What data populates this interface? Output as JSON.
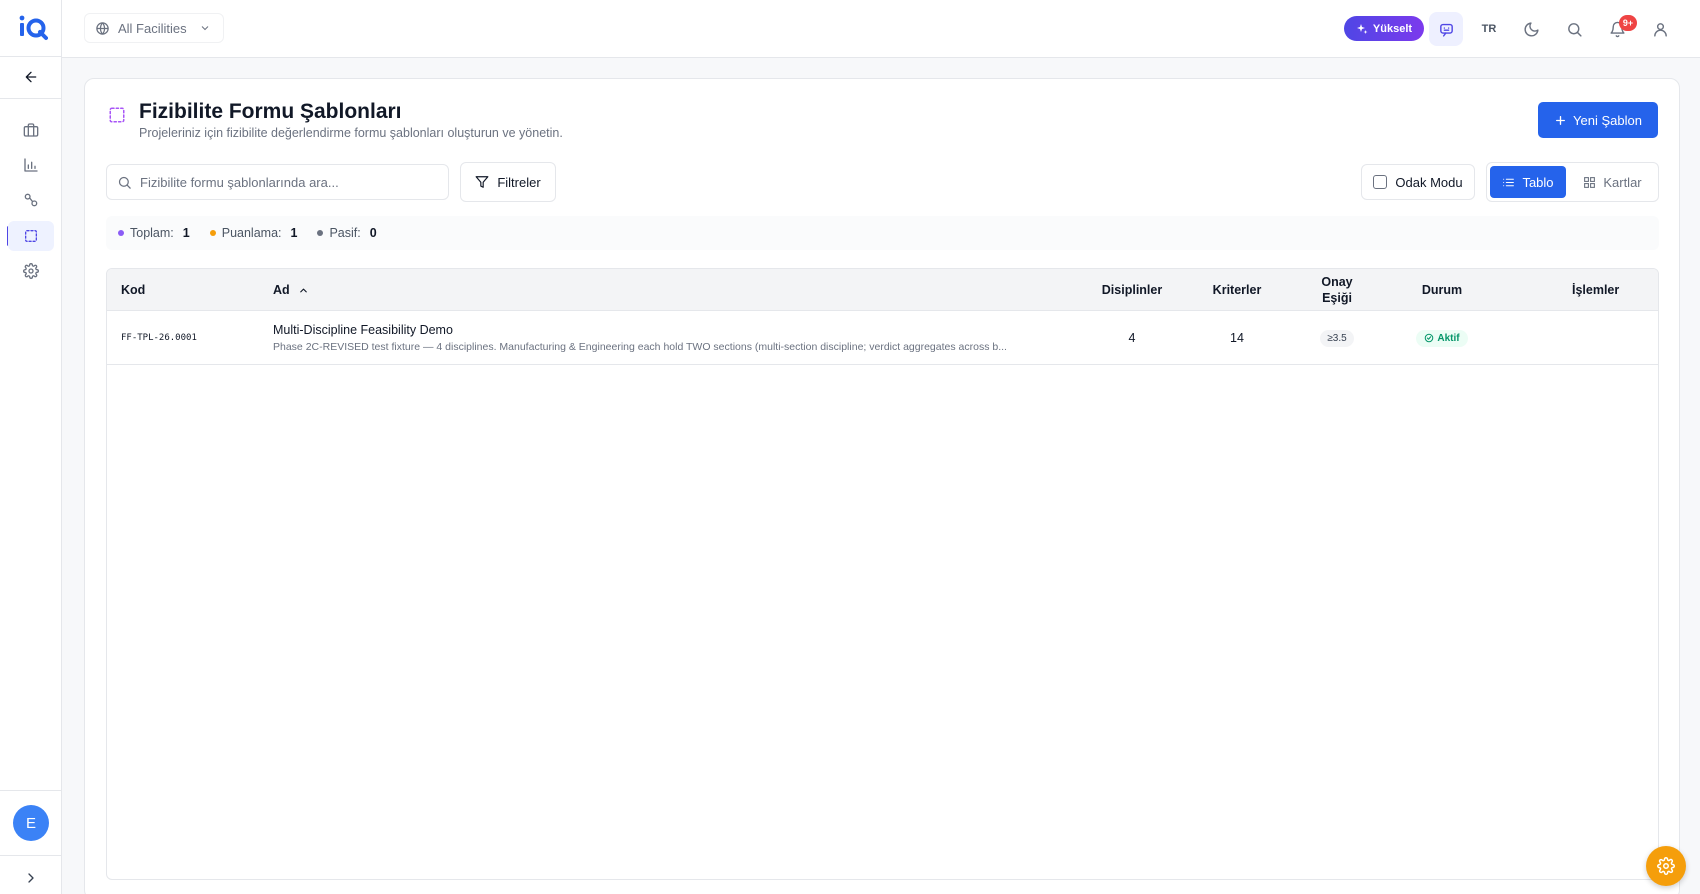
{
  "app": {
    "logo_text": "iQ",
    "brand_color": "#2563eb",
    "accent_color": "#4f46e5"
  },
  "topbar": {
    "facility_selector": "All Facilities",
    "upgrade_label": "Yükselt",
    "language": "TR",
    "notification_count": "9+"
  },
  "sidebar": {
    "items": [
      {
        "icon": "arrow-left-icon"
      },
      {
        "icon": "briefcase-icon"
      },
      {
        "icon": "bar-chart-icon"
      },
      {
        "icon": "workflow-icon"
      },
      {
        "icon": "dashed-square-icon",
        "active": true
      },
      {
        "icon": "gear-icon"
      }
    ],
    "user_initial": "E"
  },
  "page": {
    "title": "Fizibilite Formu Şablonları",
    "subtitle": "Projeleriniz için fizibilite değerlendirme formu şablonları oluşturun ve yönetin.",
    "new_button": "Yeni Şablon"
  },
  "toolbar": {
    "search_placeholder": "Fizibilite formu şablonlarında ara...",
    "filter_label": "Filtreler",
    "focus_mode_label": "Odak Modu",
    "view_table_label": "Tablo",
    "view_cards_label": "Kartlar"
  },
  "stats": [
    {
      "label": "Toplam:",
      "value": "1",
      "color": "#8b5cf6"
    },
    {
      "label": "Puanlama:",
      "value": "1",
      "color": "#f59e0b"
    },
    {
      "label": "Pasif:",
      "value": "0",
      "color": "#6b7280"
    }
  ],
  "table": {
    "columns": {
      "code": "Kod",
      "name": "Ad",
      "disciplines": "Disiplinler",
      "criteria": "Kriterler",
      "threshold_line1": "Onay",
      "threshold_line2": "Eşiği",
      "status": "Durum",
      "actions": "İşlemler"
    },
    "rows": [
      {
        "code": "FF-TPL-26.0001",
        "name": "Multi-Discipline Feasibility Demo",
        "description": "Phase 2C-REVISED test fixture — 4 disciplines. Manufacturing & Engineering each hold TWO sections (multi-section discipline; verdict aggregates across b...",
        "disciplines": "4",
        "criteria": "14",
        "threshold": "≥3.5",
        "status": "Aktif"
      }
    ]
  }
}
